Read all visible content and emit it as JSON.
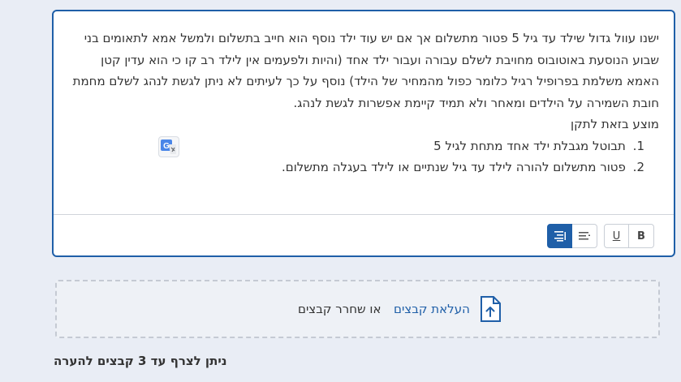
{
  "editor": {
    "paragraph": "ישנו עוול גדול שילד עד גיל 5 פטור מתשלום אך אם יש עוד ילד נוסף הוא חייב בתשלום ולמשל אמא לתאומים בני שבוע הנוסעת באוטובוס מחויבת לשלם עבורה ועבור ילד אחד (והיות ולפעמים אין לילד רב קו כי הוא עדין קטן האמא משלמת בפרופיל רגיל כלומר כפול מהמחיר של הילד) נוסף על כך לעיתים לא ניתן לגשת לנהג לשלם מחמת חובת השמירה על הילדים ומאחר ולא תמיד קיימת אפשרות לגשת לנהג.",
    "proposal_line": "מוצע בזאת לתקן",
    "items": [
      {
        "num": "1.",
        "text": "תבוטל מגבלת ילד אחד מתחת לגיל 5"
      },
      {
        "num": "2.",
        "text": "פטור מתשלום להורה לילד עד גיל שנתיים או לילד בעגלה מתשלום."
      }
    ]
  },
  "toolbar": {
    "bold_label": "B",
    "underline_label": "U",
    "align_left_icon": "align-left-icon",
    "rtl_icon": "text-direction-rtl-icon"
  },
  "translate_icon": "google-translate-icon",
  "upload": {
    "link_label": "העלאת קבצים",
    "or_label": "או שחרר קבצים",
    "icon": "file-upload-icon"
  },
  "note": "ניתן לצרף עד 3 קבצים להערה",
  "colors": {
    "accent": "#1f5fa8",
    "background": "#e9edf5"
  }
}
